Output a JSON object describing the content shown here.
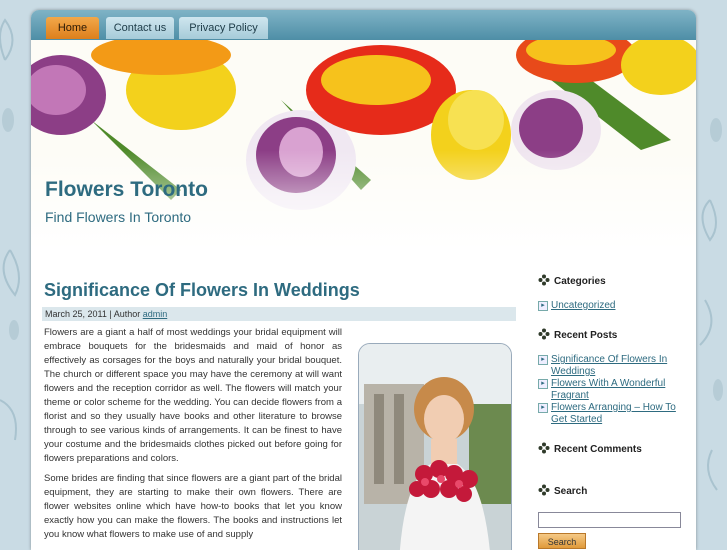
{
  "nav": {
    "home": "Home",
    "contact": "Contact us",
    "privacy": "Privacy Policy"
  },
  "header": {
    "title": "Flowers Toronto",
    "description": "Find Flowers In Toronto"
  },
  "post": {
    "title": "Significance Of Flowers In Weddings",
    "date": "March 25, 2011",
    "author_label": " | Author ",
    "author": "admin",
    "paragraphs": [
      "Flowers are a giant a half of most weddings your bridal equipment will embrace bouquets for the bridesmaids and maid of honor as effectively as corsages for the boys and naturally your bridal bouquet. The church or different space you may have the ceremony at will want flowers and the reception corridor as well. The flowers will match your theme or color scheme for the wedding. You can decide flowers from a florist and so they usually have books and other literature to browse through to see various kinds of arrangements. It can be finest to have your costume and the bridesmaids clothes picked out before going for flowers preparations and colors.",
      "Some brides are finding that since flowers are a giant part of the bridal equipment, they are starting to make their own flowers. There are flower websites online which have how-to books that let you know exactly how you can make the flowers. The books and instructions let you know what flowers to make use of and supply"
    ]
  },
  "sidebar": {
    "categories_title": "Categories",
    "categories": [
      "Uncategorized"
    ],
    "recent_posts_title": "Recent Posts",
    "recent_posts": [
      "Significance Of Flowers In Weddings",
      "Flowers With A Wonderful Fragrant",
      "Flowers Arranging – How To Get Started"
    ],
    "recent_comments_title": "Recent Comments",
    "search_title": "Search",
    "search_button": "Search"
  },
  "colors": {
    "accent": "#2e6b80",
    "nav_active": "#dd7f1c",
    "background": "#c9dbe4"
  }
}
